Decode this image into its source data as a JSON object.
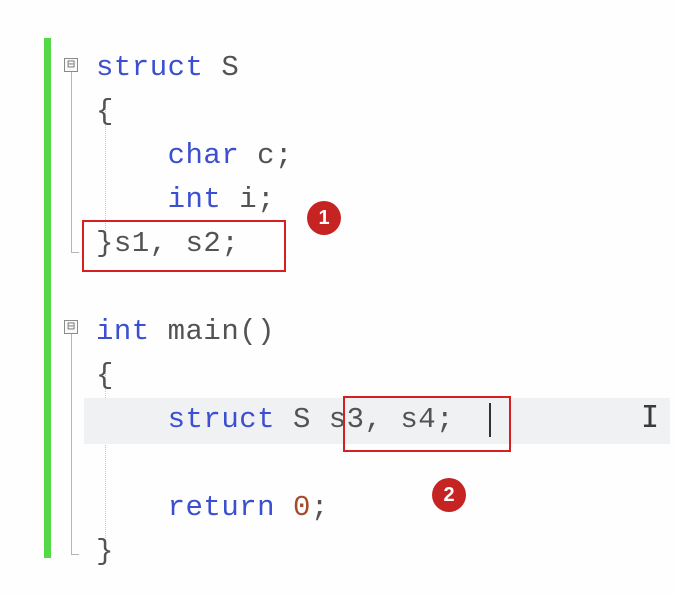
{
  "fold": {
    "minus1": "⊟",
    "minus2": "⊟"
  },
  "code": {
    "l1a": "struct",
    "l1b": " S",
    "l2": "{",
    "l3a": "    ",
    "l3b": "char",
    "l3c": " c;",
    "l4a": "    ",
    "l4b": "int",
    "l4c": " i;",
    "l5": "}s1, s2;",
    "l7a": "int",
    "l7b": " main()",
    "l8": "{",
    "l9a": "    ",
    "l9b": "struct",
    "l9c": " S ",
    "l9d": "s3, s4;",
    "l11a": "    ",
    "l11b": "return",
    "l11c": " ",
    "l11d": "0",
    "l11e": ";",
    "l12": "}"
  },
  "annotations": {
    "badge1": "1",
    "badge2": "2"
  }
}
